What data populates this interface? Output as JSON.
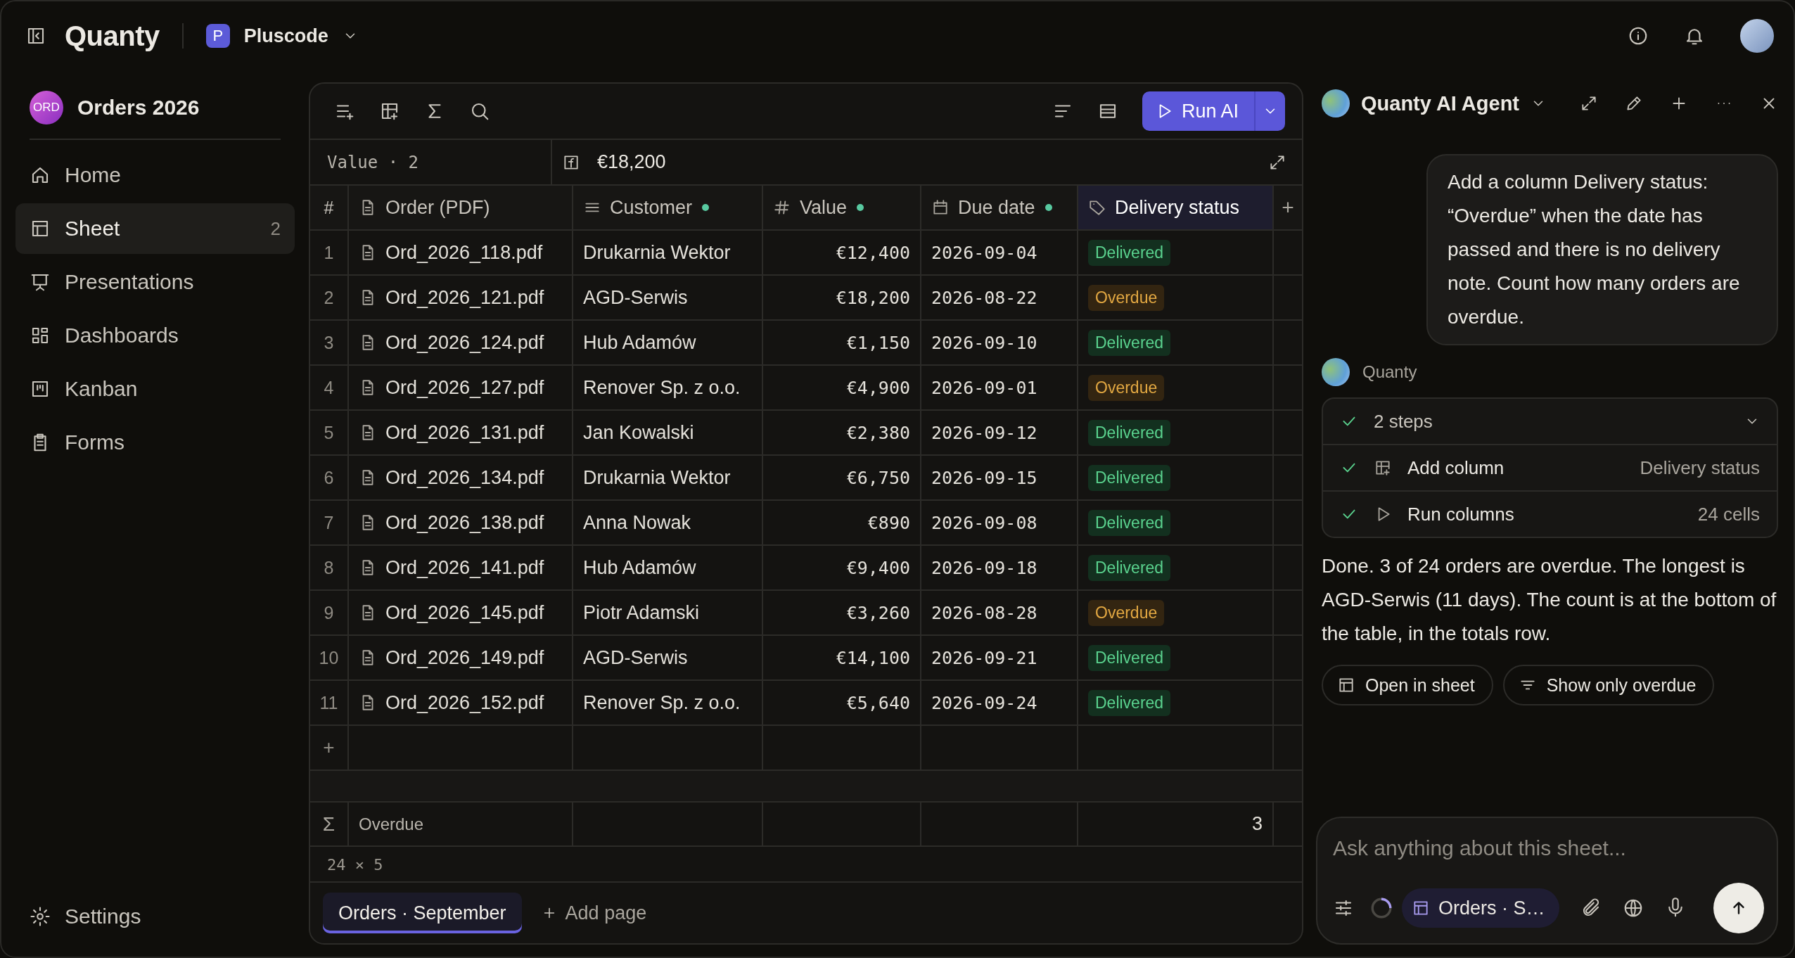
{
  "app": {
    "logo": "Quanty",
    "workspace": {
      "initial": "P",
      "name": "Pluscode"
    }
  },
  "sidebar": {
    "project": {
      "badge": "ORD",
      "name": "Orders 2026"
    },
    "items": [
      {
        "kind": "home",
        "label": "Home",
        "selected": false
      },
      {
        "kind": "sheet",
        "label": "Sheet",
        "count": "2",
        "selected": true
      },
      {
        "kind": "presentations",
        "label": "Presentations",
        "selected": false
      },
      {
        "kind": "dashboards",
        "label": "Dashboards",
        "selected": false
      },
      {
        "kind": "kanban",
        "label": "Kanban",
        "selected": false
      },
      {
        "kind": "forms",
        "label": "Forms",
        "selected": false
      }
    ],
    "settings": "Settings"
  },
  "toolbar": {
    "run_button": "Run AI"
  },
  "formula_bar": {
    "cell_ref": "Value · 2",
    "value": "€18,200"
  },
  "table": {
    "row_header": "#",
    "add_column": "+",
    "columns": [
      {
        "kind": "file",
        "label": "Order (PDF)",
        "marked": false,
        "selected": false
      },
      {
        "kind": "text",
        "label": "Customer",
        "marked": true,
        "selected": false
      },
      {
        "kind": "number",
        "label": "Value",
        "marked": true,
        "selected": false
      },
      {
        "kind": "date",
        "label": "Due date",
        "marked": true,
        "selected": false
      },
      {
        "kind": "tag",
        "label": "Delivery status",
        "marked": false,
        "selected": true
      }
    ],
    "rows": [
      {
        "number": "1",
        "order": "Ord_2026_118.pdf",
        "customer": "Drukarnia Wektor",
        "value": "€12,400",
        "due_date": "2026-09-04",
        "status": {
          "kind": "delivered",
          "label": "Delivered"
        }
      },
      {
        "number": "2",
        "order": "Ord_2026_121.pdf",
        "customer": "AGD-Serwis",
        "value": "€18,200",
        "due_date": "2026-08-22",
        "status": {
          "kind": "overdue",
          "label": "Overdue"
        }
      },
      {
        "number": "3",
        "order": "Ord_2026_124.pdf",
        "customer": "Hub Adamów",
        "value": "€1,150",
        "due_date": "2026-09-10",
        "status": {
          "kind": "delivered",
          "label": "Delivered"
        }
      },
      {
        "number": "4",
        "order": "Ord_2026_127.pdf",
        "customer": "Renover Sp. z o.o.",
        "value": "€4,900",
        "due_date": "2026-09-01",
        "status": {
          "kind": "overdue",
          "label": "Overdue"
        }
      },
      {
        "number": "5",
        "order": "Ord_2026_131.pdf",
        "customer": "Jan Kowalski",
        "value": "€2,380",
        "due_date": "2026-09-12",
        "status": {
          "kind": "delivered",
          "label": "Delivered"
        }
      },
      {
        "number": "6",
        "order": "Ord_2026_134.pdf",
        "customer": "Drukarnia Wektor",
        "value": "€6,750",
        "due_date": "2026-09-15",
        "status": {
          "kind": "delivered",
          "label": "Delivered"
        }
      },
      {
        "number": "7",
        "order": "Ord_2026_138.pdf",
        "customer": "Anna Nowak",
        "value": "€890",
        "due_date": "2026-09-08",
        "status": {
          "kind": "delivered",
          "label": "Delivered"
        }
      },
      {
        "number": "8",
        "order": "Ord_2026_141.pdf",
        "customer": "Hub Adamów",
        "value": "€9,400",
        "due_date": "2026-09-18",
        "status": {
          "kind": "delivered",
          "label": "Delivered"
        }
      },
      {
        "number": "9",
        "order": "Ord_2026_145.pdf",
        "customer": "Piotr Adamski",
        "value": "€3,260",
        "due_date": "2026-08-28",
        "status": {
          "kind": "overdue",
          "label": "Overdue"
        }
      },
      {
        "number": "10",
        "order": "Ord_2026_149.pdf",
        "customer": "AGD-Serwis",
        "value": "€14,100",
        "due_date": "2026-09-21",
        "status": {
          "kind": "delivered",
          "label": "Delivered"
        }
      },
      {
        "number": "11",
        "order": "Ord_2026_152.pdf",
        "customer": "Renover Sp. z o.o.",
        "value": "€5,640",
        "due_date": "2026-09-24",
        "status": {
          "kind": "delivered",
          "label": "Delivered"
        }
      }
    ],
    "add_row": "+",
    "totals": {
      "symbol": "Σ",
      "label": "Overdue",
      "value": "3"
    },
    "dimensions": "24 × 5"
  },
  "pages": [
    {
      "label": "Orders · September",
      "selected": true
    }
  ],
  "add_page": "Add page",
  "agent": {
    "title": "Quanty AI Agent",
    "user_message": "Add a column Delivery status: “Overdue” when the date has passed and there is no delivery note. Count how many orders are overdue.",
    "reply": {
      "author": "Quanty",
      "steps": {
        "summary": "2 steps",
        "done": true,
        "expanded": true,
        "items": [
          {
            "kind": "add_column",
            "label": "Add column",
            "detail": "Delivery status",
            "done": true
          },
          {
            "kind": "run",
            "label": "Run columns",
            "detail": "24 cells",
            "done": true
          }
        ]
      },
      "text": "Done. 3 of 24 orders are overdue. The longest is AGD-Serwis (11 days). The count is at the bottom of the table, in the totals row.",
      "actions": [
        {
          "kind": "open",
          "label": "Open in sheet"
        },
        {
          "kind": "filter",
          "label": "Show only overdue"
        }
      ]
    },
    "composer": {
      "placeholder": "Ask anything about this sheet...",
      "context": "Orders · S…"
    }
  }
}
